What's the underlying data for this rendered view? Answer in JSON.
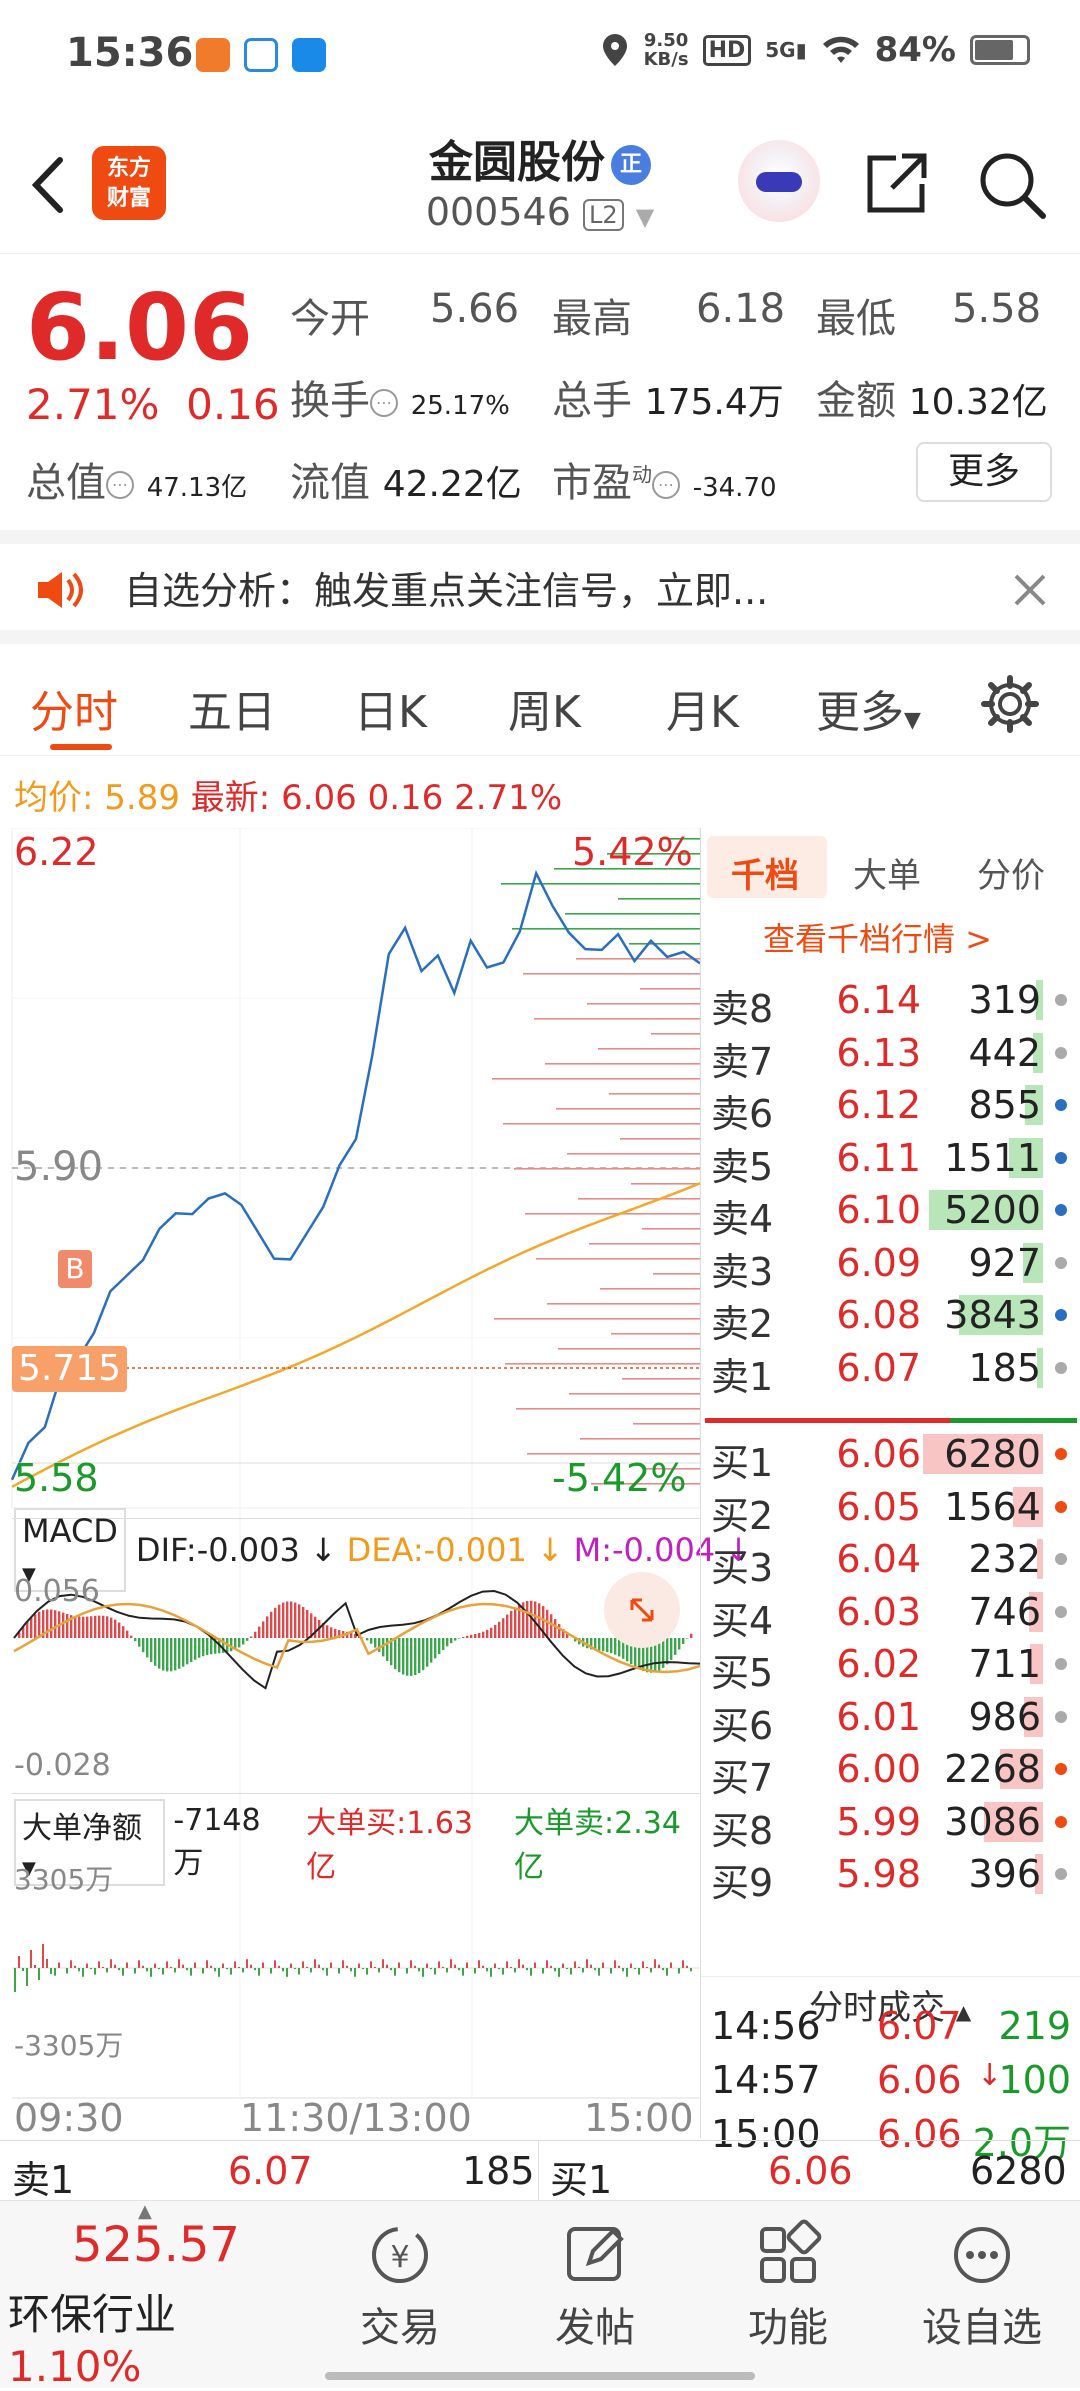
{
  "status_bar": {
    "time": "15:36",
    "net_speed_value": "9.50",
    "net_speed_unit": "KB/s",
    "signal": "5G",
    "battery": "84%"
  },
  "header": {
    "logo_line1": "东方",
    "logo_line2": "财富",
    "stock_name": "金圆股份",
    "badge": "正",
    "stock_code": "000546",
    "level": "L2"
  },
  "quote": {
    "price": "6.06",
    "change_pct": "2.71%",
    "change": "0.16",
    "open_label": "今开",
    "open": "5.66",
    "high_label": "最高",
    "high": "6.18",
    "low_label": "最低",
    "low": "5.58",
    "turnover_label": "换手",
    "turnover": "25.17%",
    "volume_label": "总手",
    "volume": "175.4万",
    "amount_label": "金额",
    "amount": "10.32亿",
    "mktcap_label": "总值",
    "mktcap": "47.13亿",
    "float_label": "流值",
    "float": "42.22亿",
    "pe_label": "市盈",
    "pe_sup": "动",
    "pe": "-34.70",
    "more": "更多"
  },
  "notice": {
    "text": "自选分析：触发重点关注信号，立即..."
  },
  "tabs": [
    "分时",
    "五日",
    "日K",
    "周K",
    "月K",
    "更多"
  ],
  "avg_line": {
    "avg_label": "均价:",
    "avg": "5.89",
    "latest_label": "最新:",
    "latest": "6.06",
    "change": "0.16",
    "pct": "2.71%"
  },
  "chart": {
    "y_high": "6.22",
    "y_low": "5.58",
    "pct_high": "5.42%",
    "pct_low": "-5.42%",
    "mid_price": "5.90",
    "marker_b": "B",
    "marker_price": "5.715",
    "macd_label": "MACD",
    "dif": "DIF:-0.003",
    "dea": "DEA:-0.001",
    "m": "M:-0.004",
    "macd_high": "0.056",
    "macd_low": "-0.028",
    "flow_label": "大单净额",
    "flow_value": "-7148万",
    "flow_buy": "大单买:1.63亿",
    "flow_sell": "大单卖:2.34亿",
    "flow_high": "3305万",
    "flow_low": "-3305万",
    "time_start": "09:30",
    "time_mid": "11:30/13:00",
    "time_end": "15:00"
  },
  "orderbook": {
    "tabs": [
      "千档",
      "大单",
      "分价"
    ],
    "link": "查看千档行情 >",
    "asks": [
      {
        "label": "卖8",
        "price": "6.14",
        "qty": "319",
        "bar": 0.06
      },
      {
        "label": "卖7",
        "price": "6.13",
        "qty": "442",
        "bar": 0.08
      },
      {
        "label": "卖6",
        "price": "6.12",
        "qty": "855",
        "bar": 0.15
      },
      {
        "label": "卖5",
        "price": "6.11",
        "qty": "1511",
        "bar": 0.28
      },
      {
        "label": "卖4",
        "price": "6.10",
        "qty": "5200",
        "bar": 0.95
      },
      {
        "label": "卖3",
        "price": "6.09",
        "qty": "927",
        "bar": 0.17
      },
      {
        "label": "卖2",
        "price": "6.08",
        "qty": "3843",
        "bar": 0.7
      },
      {
        "label": "卖1",
        "price": "6.07",
        "qty": "185",
        "bar": 0.04
      }
    ],
    "bids": [
      {
        "label": "买1",
        "price": "6.06",
        "qty": "6280",
        "bar": 1.0
      },
      {
        "label": "买2",
        "price": "6.05",
        "qty": "1564",
        "bar": 0.25
      },
      {
        "label": "买3",
        "price": "6.04",
        "qty": "232",
        "bar": 0.05
      },
      {
        "label": "买4",
        "price": "6.03",
        "qty": "746",
        "bar": 0.12
      },
      {
        "label": "买5",
        "price": "6.02",
        "qty": "711",
        "bar": 0.11
      },
      {
        "label": "买6",
        "price": "6.01",
        "qty": "986",
        "bar": 0.16
      },
      {
        "label": "买7",
        "price": "6.00",
        "qty": "2268",
        "bar": 0.36
      },
      {
        "label": "买8",
        "price": "5.99",
        "qty": "3086",
        "bar": 0.49
      },
      {
        "label": "买9",
        "price": "5.98",
        "qty": "396",
        "bar": 0.07
      }
    ],
    "trades_title": "分时成交",
    "trades": [
      {
        "time": "14:56",
        "price": "6.07",
        "vol": "219",
        "arrow": ""
      },
      {
        "time": "14:57",
        "price": "6.06",
        "vol": "100",
        "arrow": "↓"
      },
      {
        "time": "15:00",
        "price": "6.06",
        "vol": "2.0万",
        "arrow": ""
      }
    ]
  },
  "sellbuy": {
    "sell_label": "卖1",
    "sell_price": "6.07",
    "sell_qty": "185",
    "buy_label": "买1",
    "buy_price": "6.06",
    "buy_qty": "6280"
  },
  "bottom": {
    "index_value": "525.57",
    "index_name": "环保行业",
    "index_pct": "1.10%",
    "nav": [
      "交易",
      "发帖",
      "功能",
      "设自选"
    ]
  },
  "colors": {
    "up": "#e02a2a",
    "down": "#1a9a2a",
    "accent": "#f04a13",
    "avg": "#f29a1a"
  }
}
